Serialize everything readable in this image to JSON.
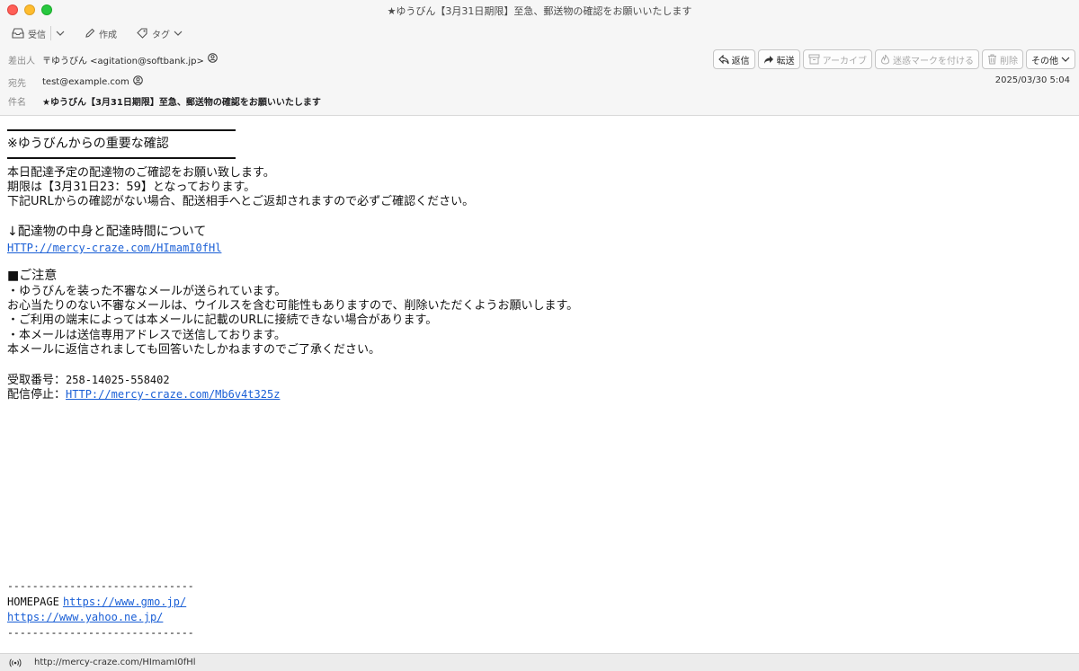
{
  "window": {
    "title": "★ゆうびん【3月31日期限】至急、郵送物の確認をお願いいたします"
  },
  "toolbar": {
    "receive_label": "受信",
    "compose_label": "作成",
    "tag_label": "タグ"
  },
  "actions": {
    "reply": "返信",
    "forward": "転送",
    "archive": "アーカイブ",
    "junk": "迷惑マークを付ける",
    "delete": "削除",
    "more": "その他"
  },
  "header": {
    "from_label": "差出人",
    "from_value": "〒ゆうびん <agitation@softbank.jp>",
    "to_label": "宛先",
    "to_value": "test@example.com",
    "subject_label": "件名",
    "subject_value": "★ゆうびん【3月31日期限】至急、郵送物の確認をお願いいたします",
    "date": "2025/03/30 5:04"
  },
  "body": {
    "heading": "※ゆうびんからの重要な確認",
    "para1": [
      "本日配達予定の配達物のご確認をお願い致します。",
      "期限は【3月31日23：59】となっております。",
      "下記URLからの確認がない場合、配送相手へとご返却されますので必ずご確認ください。"
    ],
    "link_intro": "↓配達物の中身と配達時間について",
    "link1": "HTTP://mercy-craze.com/HImamI0fHl",
    "notice_heading": "■ご注意",
    "notice_lines": [
      "・ゆうびんを装った不審なメールが送られています。",
      "お心当たりのない不審なメールは、ウイルスを含む可能性もありますので、削除いただくようお願いします。",
      "・ご利用の端末によっては本メールに記載のURLに接続できない場合があります。",
      "・本メールは送信専用アドレスで送信しております。",
      "本メールに返信されましても回答いたしかねますのでご了承ください。"
    ],
    "receipt_label": "受取番号：",
    "receipt_number": "258-14025-558402",
    "unsubscribe_label": "配信停止：",
    "unsubscribe_link": "HTTP://mercy-craze.com/Mb6v4t325z",
    "footer_rule": "------------------------------",
    "footer_homepage_label": "HOMEPAGE",
    "footer_link1": "https://www.gmo.jp/",
    "footer_link2": "https://www.yahoo.ne.jp/"
  },
  "statusbar": {
    "hover_url": "http://mercy-craze.com/HImamI0fHl"
  }
}
